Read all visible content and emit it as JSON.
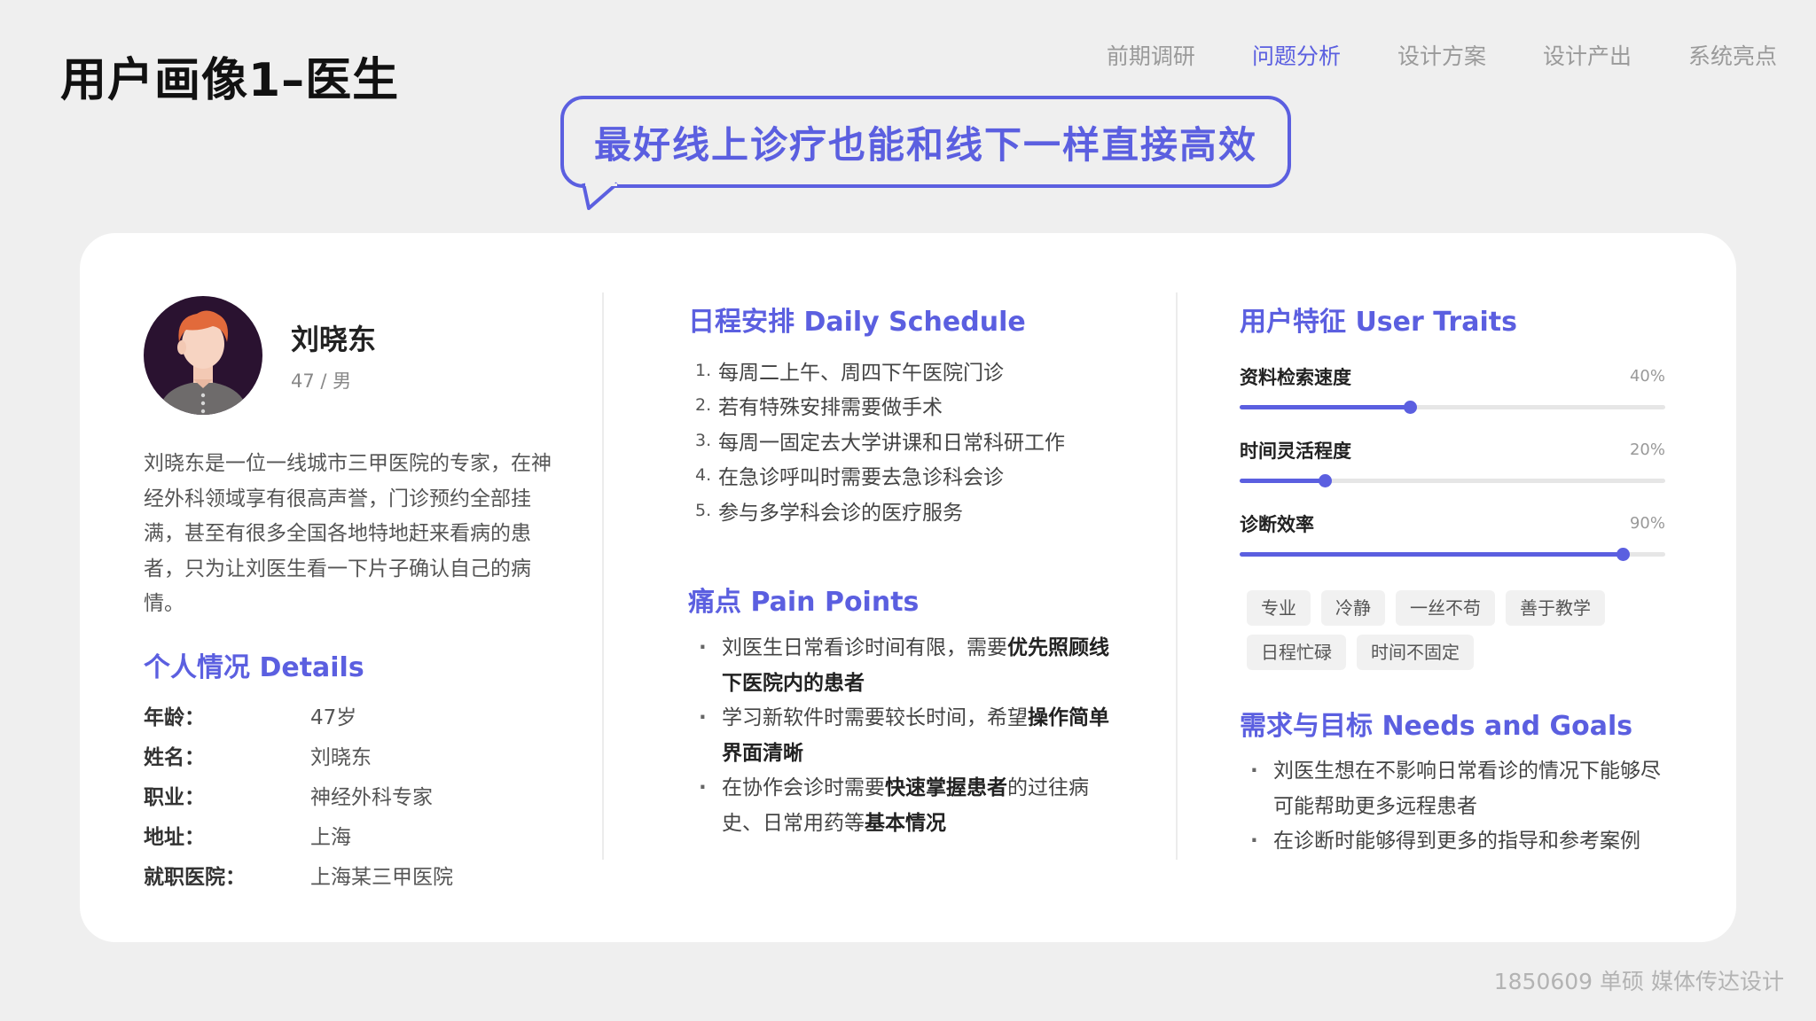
{
  "page_title": "用户画像1–医生",
  "nav": [
    {
      "label": "前期调研",
      "active": false
    },
    {
      "label": "问题分析",
      "active": true
    },
    {
      "label": "设计方案",
      "active": false
    },
    {
      "label": "设计产出",
      "active": false
    },
    {
      "label": "系统亮点",
      "active": false
    }
  ],
  "quote": "最好线上诊疗也能和线下一样直接高效",
  "profile": {
    "name": "刘晓东",
    "sub": "47 / 男",
    "bio": "刘晓东是一位一线城市三甲医院的专家，在神经外科领域享有很高声誉，门诊预约全部挂满，甚至有很多全国各地特地赶来看病的患者，只为让刘医生看一下片子确认自己的病情。"
  },
  "details": {
    "heading": "个人情况 Details",
    "rows": [
      {
        "label": "年龄：",
        "value": "47岁"
      },
      {
        "label": "姓名：",
        "value": "刘晓东"
      },
      {
        "label": "职业：",
        "value": "神经外科专家"
      },
      {
        "label": "地址：",
        "value": "上海"
      },
      {
        "label": "就职医院：",
        "value": "上海某三甲医院"
      }
    ]
  },
  "schedule": {
    "heading": "日程安排 Daily Schedule",
    "items": [
      {
        "num": "1.",
        "text": "每周二上午、周四下午医院门诊"
      },
      {
        "num": "2.",
        "text": "若有特殊安排需要做手术"
      },
      {
        "num": "3.",
        "text": "每周一固定去大学讲课和日常科研工作"
      },
      {
        "num": "4.",
        "text": "在急诊呼叫时需要去急诊科会诊"
      },
      {
        "num": "5.",
        "text": "参与多学科会诊的医疗服务"
      }
    ]
  },
  "pain_points": {
    "heading": "痛点 Pain Points",
    "items": [
      [
        {
          "text": "刘医生日常看诊时间有限，需要",
          "bold": false
        },
        {
          "text": "优先照顾线下医院内的患者",
          "bold": true
        }
      ],
      [
        {
          "text": "学习新软件时需要较长时间，希望",
          "bold": false
        },
        {
          "text": "操作简单界面清晰",
          "bold": true
        }
      ],
      [
        {
          "text": "在协作会诊时需要",
          "bold": false
        },
        {
          "text": "快速掌握患者",
          "bold": true
        },
        {
          "text": "的过往病史、日常用药等",
          "bold": false
        },
        {
          "text": "基本情况",
          "bold": true
        }
      ]
    ]
  },
  "traits": {
    "heading": "用户特征 User Traits",
    "items": [
      {
        "label": "资料检索速度",
        "value": 40,
        "display": "40%"
      },
      {
        "label": "时间灵活程度",
        "value": 20,
        "display": "20%"
      },
      {
        "label": "诊断效率",
        "value": 90,
        "display": "90%"
      }
    ],
    "tags": [
      "专业",
      "冷静",
      "一丝不苟",
      "善于教学",
      "日程忙碌",
      "时间不固定"
    ]
  },
  "needs": {
    "heading": "需求与目标 Needs and Goals",
    "items": [
      "刘医生想在不影响日常看诊的情况下能够尽可能帮助更多远程患者",
      "在诊断时能够得到更多的指导和参考案例"
    ]
  },
  "footer": "1850609 单硕 媒体传达设计",
  "colors": {
    "accent": "#5b5fe0",
    "background": "#efefef",
    "card": "#ffffff"
  }
}
